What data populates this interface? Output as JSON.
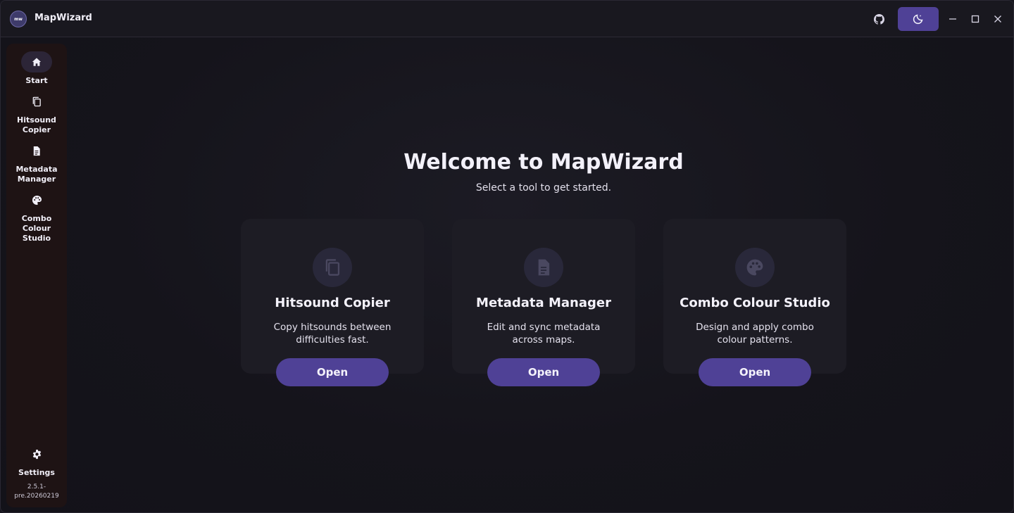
{
  "app": {
    "title": "MapWizard",
    "logo_text": "mw",
    "accent_color": "#4f4196"
  },
  "titlebar": {
    "icons": [
      "github-icon",
      "moon-icon",
      "minimize-icon",
      "maximize-icon",
      "close-icon"
    ]
  },
  "sidebar": {
    "items": [
      {
        "label": "Start",
        "icon": "home-icon",
        "active": true
      },
      {
        "label": "Hitsound\nCopier",
        "icon": "copy-icon",
        "active": false
      },
      {
        "label": "Metadata\nManager",
        "icon": "document-icon",
        "active": false
      },
      {
        "label": "Combo\nColour\nStudio",
        "icon": "palette-icon",
        "active": false
      }
    ],
    "settings": {
      "label": "Settings",
      "icon": "gear-icon"
    },
    "version": "2.5.1-\npre.20260219"
  },
  "main": {
    "title": "Welcome to MapWizard",
    "subtitle": "Select a tool to get started.",
    "cards": [
      {
        "title": "Hitsound Copier",
        "description": "Copy hitsounds between difficulties fast.",
        "button": "Open",
        "icon": "copy-icon"
      },
      {
        "title": "Metadata Manager",
        "description": "Edit and sync metadata across maps.",
        "button": "Open",
        "icon": "document-icon"
      },
      {
        "title": "Combo Colour Studio",
        "description": "Design and apply combo colour patterns.",
        "button": "Open",
        "icon": "palette-icon"
      }
    ]
  }
}
